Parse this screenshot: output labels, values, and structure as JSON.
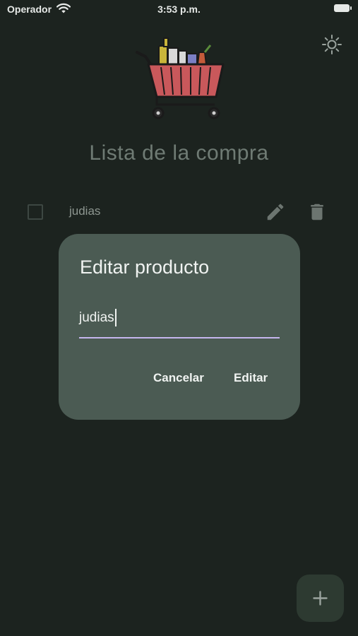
{
  "status_bar": {
    "carrier": "Operador",
    "time": "3:53 p.m."
  },
  "header": {
    "title": "Lista de la compra",
    "theme_icon": "sun-icon",
    "logo_icon": "shopping-cart-icon"
  },
  "list": {
    "items": [
      {
        "label": "judias",
        "checked": false,
        "edit_icon": "pencil-icon",
        "delete_icon": "trash-icon"
      }
    ]
  },
  "dialog": {
    "title": "Editar producto",
    "input_value": "judias",
    "cancel_label": "Cancelar",
    "confirm_label": "Editar"
  },
  "fab": {
    "icon": "plus-icon"
  },
  "colors": {
    "background": "#1c231f",
    "dialog": "#4b5b53",
    "accent_underline": "#c5b6ee",
    "fab": "#2d3a31"
  }
}
